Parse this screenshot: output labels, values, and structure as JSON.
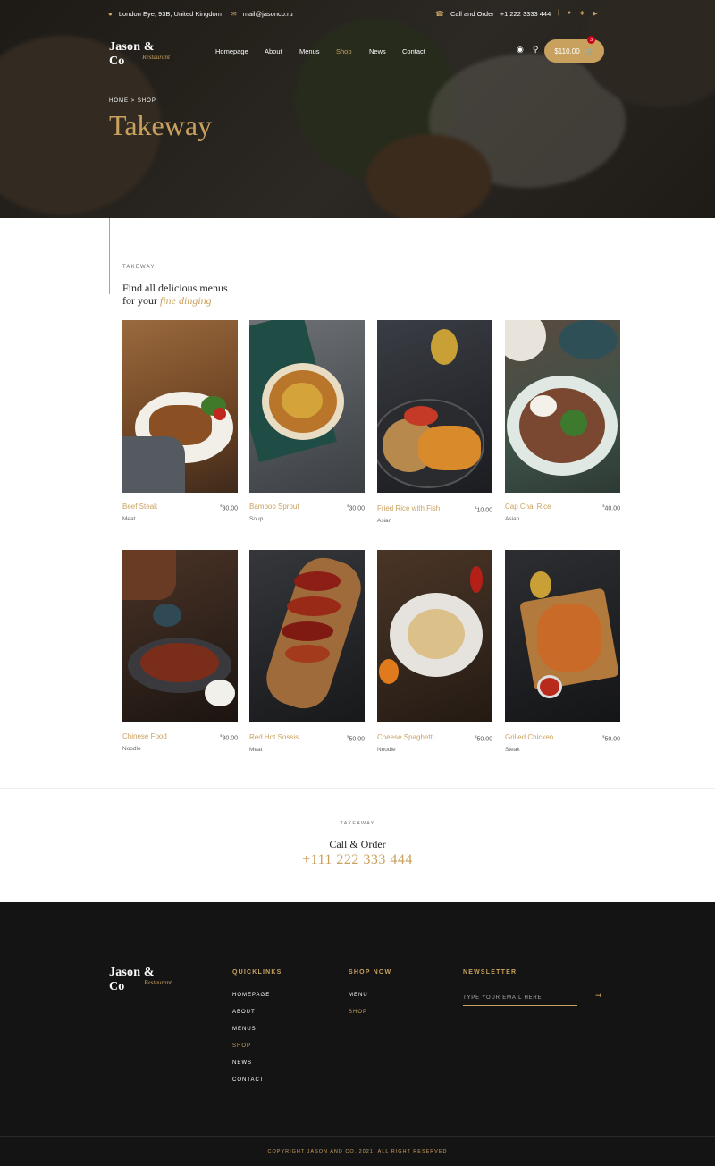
{
  "topbar": {
    "address": "London Eye, 93B, United Kingdom",
    "email": "mail@jasonco.ru",
    "call_label": "Call and Order",
    "call_number": "+1 222 3333 444",
    "separator": "|"
  },
  "brand": {
    "name": "Jason & Co",
    "sub": "Restaurant"
  },
  "nav": [
    {
      "label": "Homepage"
    },
    {
      "label": "About"
    },
    {
      "label": "Menus"
    },
    {
      "label": "Shop",
      "active": true
    },
    {
      "label": "News"
    },
    {
      "label": "Contact"
    }
  ],
  "cart": {
    "total": "$110.00",
    "count": "3"
  },
  "hero": {
    "breadcrumb": "HOME > SHOP",
    "title": "Takeway"
  },
  "section": {
    "label": "TAKEWAY",
    "title_line1": "Find all delicious menus",
    "title_line2_prefix": "for your ",
    "title_line2_em": "fine dinging"
  },
  "products": [
    {
      "name": "Beef Steak",
      "price": "30.00",
      "currency": "$",
      "category": "Meat"
    },
    {
      "name": "Bamboo Sprout",
      "price": "30.00",
      "currency": "$",
      "category": "Soup"
    },
    {
      "name": "Fried Rice with Fish",
      "price": "10.00",
      "currency": "$",
      "category": "Asian"
    },
    {
      "name": "Cap Chai Rice",
      "price": "40.00",
      "currency": "$",
      "category": "Asian"
    },
    {
      "name": "Chinese Food",
      "price": "30.00",
      "currency": "$",
      "category": "Noodle"
    },
    {
      "name": "Red Hot Sossis",
      "price": "50.00",
      "currency": "$",
      "category": "Meat"
    },
    {
      "name": "Cheese Spaghetti",
      "price": "50.00",
      "currency": "$",
      "category": "Noodle"
    },
    {
      "name": "Grilled Chicken",
      "price": "50.00",
      "currency": "$",
      "category": "Steak"
    }
  ],
  "call_order": {
    "label": "TAKEAWAY",
    "title": "Call & Order",
    "phone": "+111 222 333 444"
  },
  "footer": {
    "quicklinks_title": "QUICKLINKS",
    "quicklinks": [
      {
        "label": "HOMEPAGE"
      },
      {
        "label": "ABOUT"
      },
      {
        "label": "MENUS"
      },
      {
        "label": "SHOP",
        "active": true
      },
      {
        "label": "NEWS"
      },
      {
        "label": "CONTACT"
      }
    ],
    "shop_title": "SHOP NOW",
    "shop_links": [
      {
        "label": "MENU"
      },
      {
        "label": "SHOP",
        "active": true
      }
    ],
    "newsletter_title": "NEWSLETTER",
    "newsletter_placeholder": "TYPE YOUR EMAIL HERE",
    "copyright": "COPYRIGHT JASON AND CO. 2021. ALL RIGHT RESERVED"
  },
  "colors": {
    "accent": "#c9a15f",
    "footer_bg": "#141414",
    "badge": "#d0021b"
  },
  "icons": [
    "map-pin-icon",
    "mail-icon",
    "phone-icon",
    "facebook-icon",
    "twitter-icon",
    "youtube-icon",
    "user-icon",
    "search-icon",
    "cart-icon",
    "arrow-right-icon"
  ]
}
